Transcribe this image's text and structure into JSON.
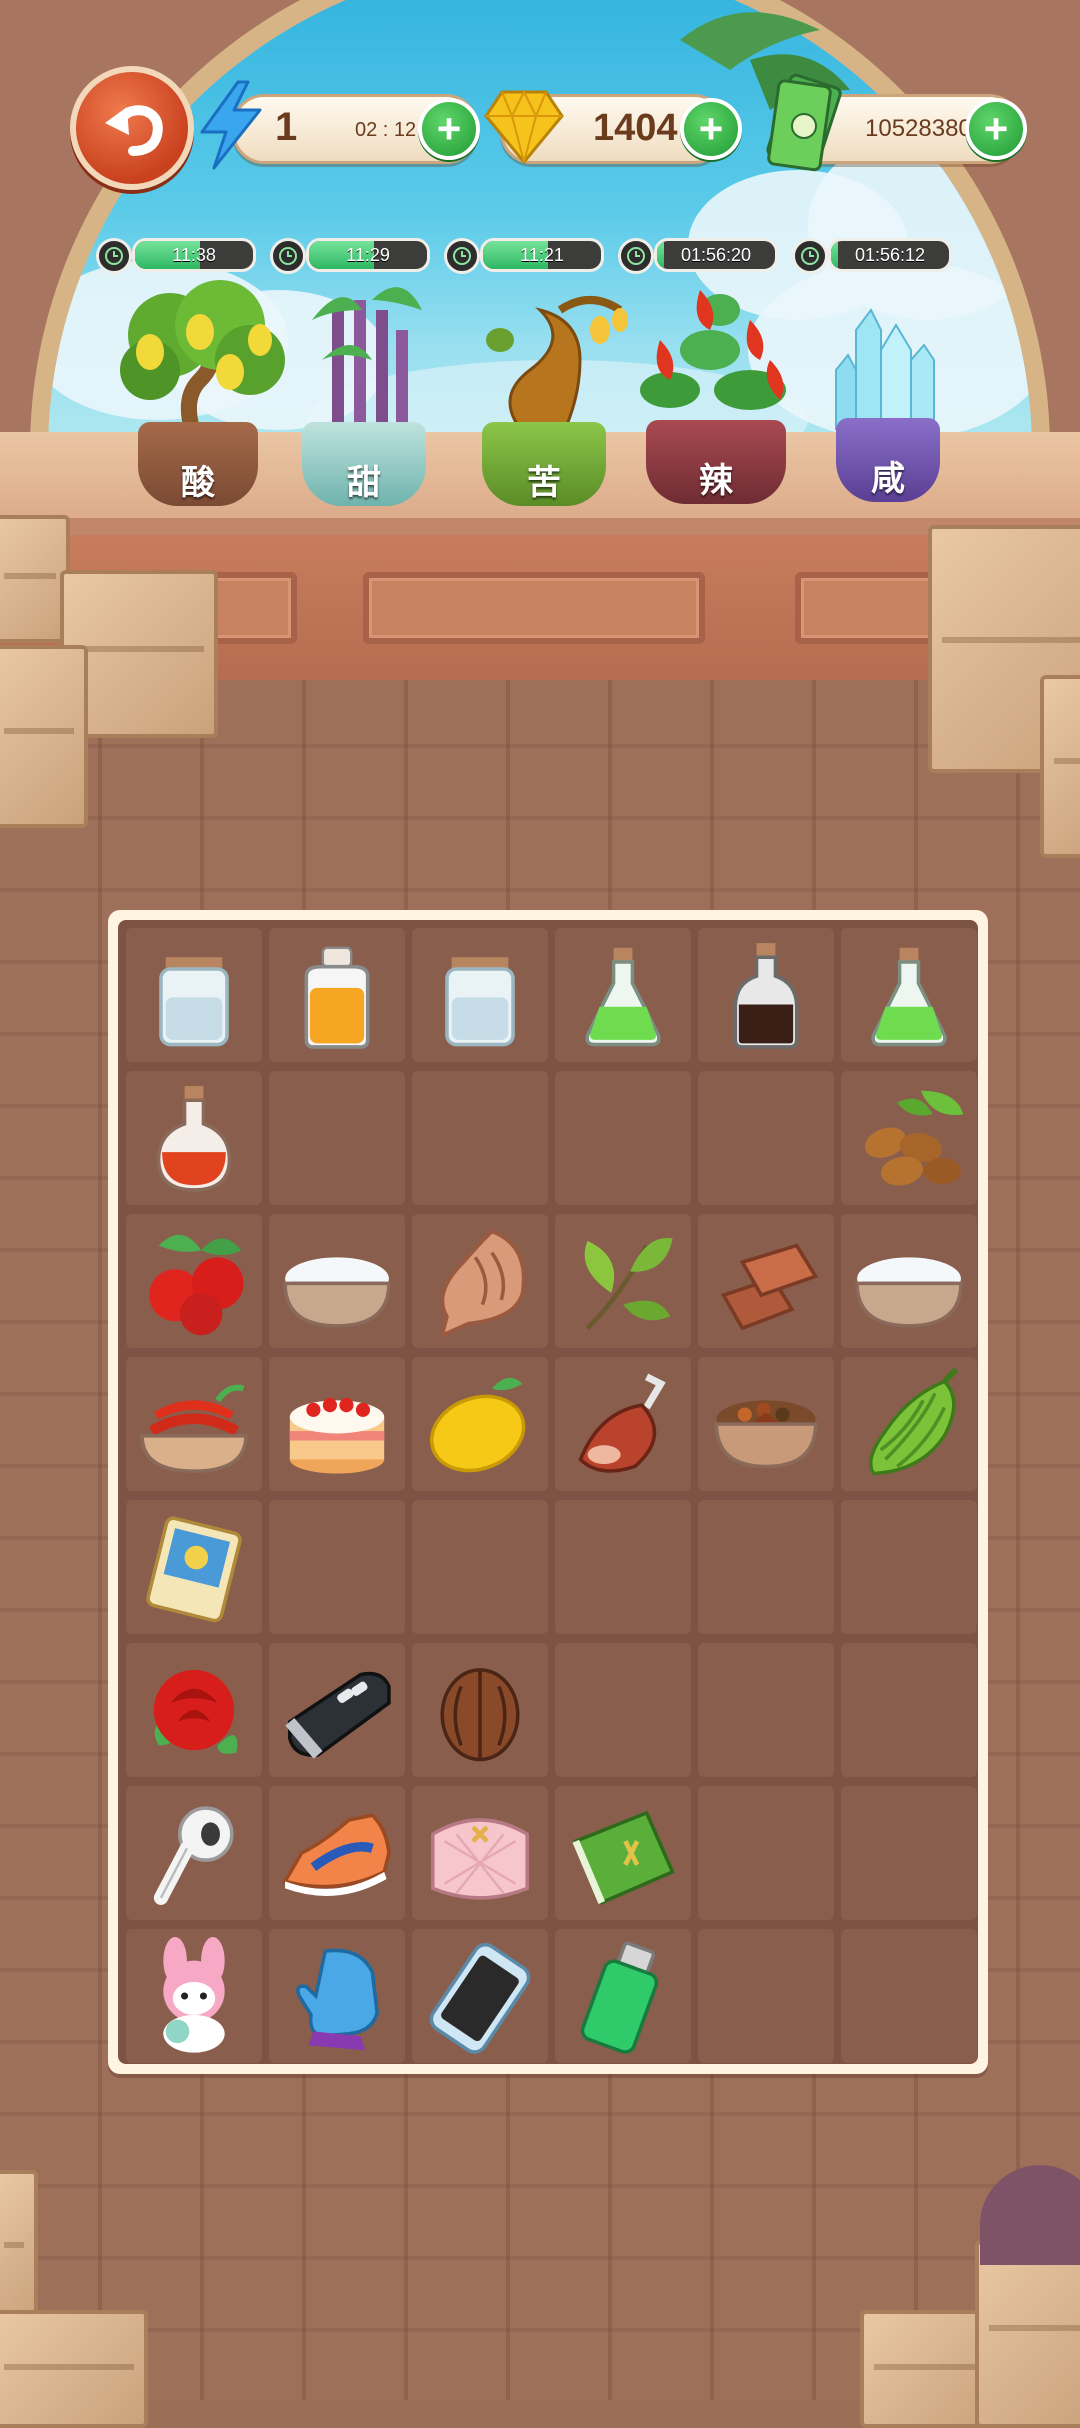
{
  "hud": {
    "energy_value": "1",
    "energy_timer": "02 : 12",
    "gems_value": "1404",
    "cash_value": "10528380",
    "plus_symbol": "+"
  },
  "plants": [
    {
      "label": "酸",
      "timer": "11:38",
      "progress": 0.55
    },
    {
      "label": "甜",
      "timer": "11:29",
      "progress": 0.55
    },
    {
      "label": "苦",
      "timer": "11:21",
      "progress": 0.55
    },
    {
      "label": "辣",
      "timer": "01:56:20",
      "progress": 0.06
    },
    {
      "label": "咸",
      "timer": "01:56:12",
      "progress": 0.06
    }
  ],
  "grid_rows": [
    [
      "salt-jar-icon",
      "honey-jar-icon",
      "salt-jar-icon",
      "green-potion-icon",
      "soy-sauce-bottle-icon",
      "green-potion-icon"
    ],
    [
      "chili-oil-bottle-icon",
      "",
      "",
      "",
      "",
      "coffee-beans-icon"
    ],
    [
      "red-berries-icon",
      "salt-bowl-icon",
      "dried-fish-icon",
      "tea-leaves-icon",
      "brown-sugar-icon",
      "salt-bowl-icon"
    ],
    [
      "chili-peppers-icon",
      "strawberry-cake-icon",
      "lemon-icon",
      "ham-leg-icon",
      "spice-bowl-icon",
      "bitter-melon-icon"
    ],
    [
      "trading-card-icon",
      "",
      "",
      "",
      "",
      ""
    ],
    [
      "rose-icon",
      "car-key-icon",
      "walnut-icon",
      "",
      "",
      ""
    ],
    [
      "earbud-icon",
      "sneaker-icon",
      "pink-purse-icon",
      "green-notebook-icon",
      "",
      ""
    ],
    [
      "bunny-doll-icon",
      "mitten-icon",
      "smartphone-icon",
      "lighter-icon",
      "",
      ""
    ]
  ],
  "colors": {
    "accent_green": "#2eb763",
    "back_button": "#d9502c",
    "board_bg": "#7c5345"
  }
}
